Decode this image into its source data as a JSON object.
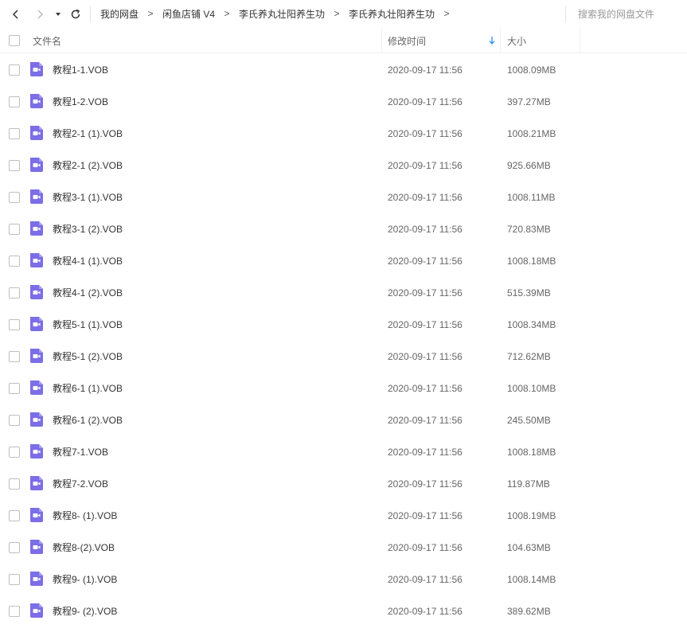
{
  "toolbar": {
    "breadcrumb": [
      "我的网盘",
      "闲鱼店铺 V4",
      "李氏养丸壮阳养生功",
      "李氏养丸壮阳养生功"
    ],
    "crumb_separator": ">",
    "search_placeholder": "搜索我的网盘文件"
  },
  "columns": {
    "name": "文件名",
    "modified": "修改时间",
    "size": "大小",
    "sort_column": "修改时间",
    "sort_direction": "descending"
  },
  "colors": {
    "video_icon": "#7b6ee6",
    "sort_arrow": "#2d8cf0"
  },
  "icons": {
    "back": "chevron-left-icon",
    "forward": "chevron-right-icon",
    "dropdown": "caret-down-icon",
    "refresh": "refresh-icon",
    "file": "video-file-icon",
    "sort": "sort-down-arrow-icon"
  },
  "files": [
    {
      "name": "教程1-1.VOB",
      "modified": "2020-09-17 11:56",
      "size": "1008.09MB"
    },
    {
      "name": "教程1-2.VOB",
      "modified": "2020-09-17 11:56",
      "size": "397.27MB"
    },
    {
      "name": "教程2-1 (1).VOB",
      "modified": "2020-09-17 11:56",
      "size": "1008.21MB"
    },
    {
      "name": "教程2-1 (2).VOB",
      "modified": "2020-09-17 11:56",
      "size": "925.66MB"
    },
    {
      "name": "教程3-1 (1).VOB",
      "modified": "2020-09-17 11:56",
      "size": "1008.11MB"
    },
    {
      "name": "教程3-1 (2).VOB",
      "modified": "2020-09-17 11:56",
      "size": "720.83MB"
    },
    {
      "name": "教程4-1 (1).VOB",
      "modified": "2020-09-17 11:56",
      "size": "1008.18MB"
    },
    {
      "name": "教程4-1 (2).VOB",
      "modified": "2020-09-17 11:56",
      "size": "515.39MB"
    },
    {
      "name": "教程5-1 (1).VOB",
      "modified": "2020-09-17 11:56",
      "size": "1008.34MB"
    },
    {
      "name": "教程5-1 (2).VOB",
      "modified": "2020-09-17 11:56",
      "size": "712.62MB"
    },
    {
      "name": "教程6-1 (1).VOB",
      "modified": "2020-09-17 11:56",
      "size": "1008.10MB"
    },
    {
      "name": "教程6-1 (2).VOB",
      "modified": "2020-09-17 11:56",
      "size": "245.50MB"
    },
    {
      "name": "教程7-1.VOB",
      "modified": "2020-09-17 11:56",
      "size": "1008.18MB"
    },
    {
      "name": "教程7-2.VOB",
      "modified": "2020-09-17 11:56",
      "size": "119.87MB"
    },
    {
      "name": "教程8- (1).VOB",
      "modified": "2020-09-17 11:56",
      "size": "1008.19MB"
    },
    {
      "name": "教程8-(2).VOB",
      "modified": "2020-09-17 11:56",
      "size": "104.63MB"
    },
    {
      "name": "教程9- (1).VOB",
      "modified": "2020-09-17 11:56",
      "size": "1008.14MB"
    },
    {
      "name": "教程9- (2).VOB",
      "modified": "2020-09-17 11:56",
      "size": "389.62MB"
    }
  ]
}
